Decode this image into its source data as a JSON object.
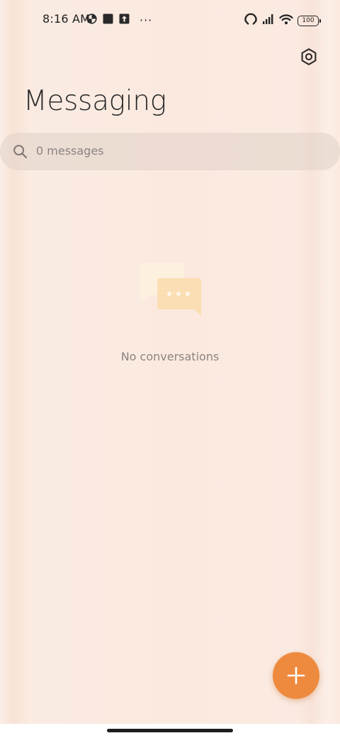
{
  "status_bar": {
    "time": "8:16 AM",
    "left_icons": [
      "data-saver-icon",
      "square-notification-icon",
      "upload-notification-icon",
      "more-notifications-icon"
    ],
    "more_indicator": "···",
    "right_icons": [
      "hotspot-icon",
      "signal-icon",
      "wifi-icon",
      "battery-icon"
    ],
    "battery_level": "100"
  },
  "header": {
    "title": "Messaging",
    "settings_icon": "settings-icon"
  },
  "search": {
    "placeholder": "0 messages"
  },
  "empty_state": {
    "illustration": "chat-bubbles-icon",
    "message": "No conversations"
  },
  "fab": {
    "icon": "plus-icon",
    "color": "#ee8a3e"
  },
  "colors": {
    "background": "#fbeae0",
    "accent": "#ee8a3e",
    "search_bg": "#e8dcd3"
  }
}
